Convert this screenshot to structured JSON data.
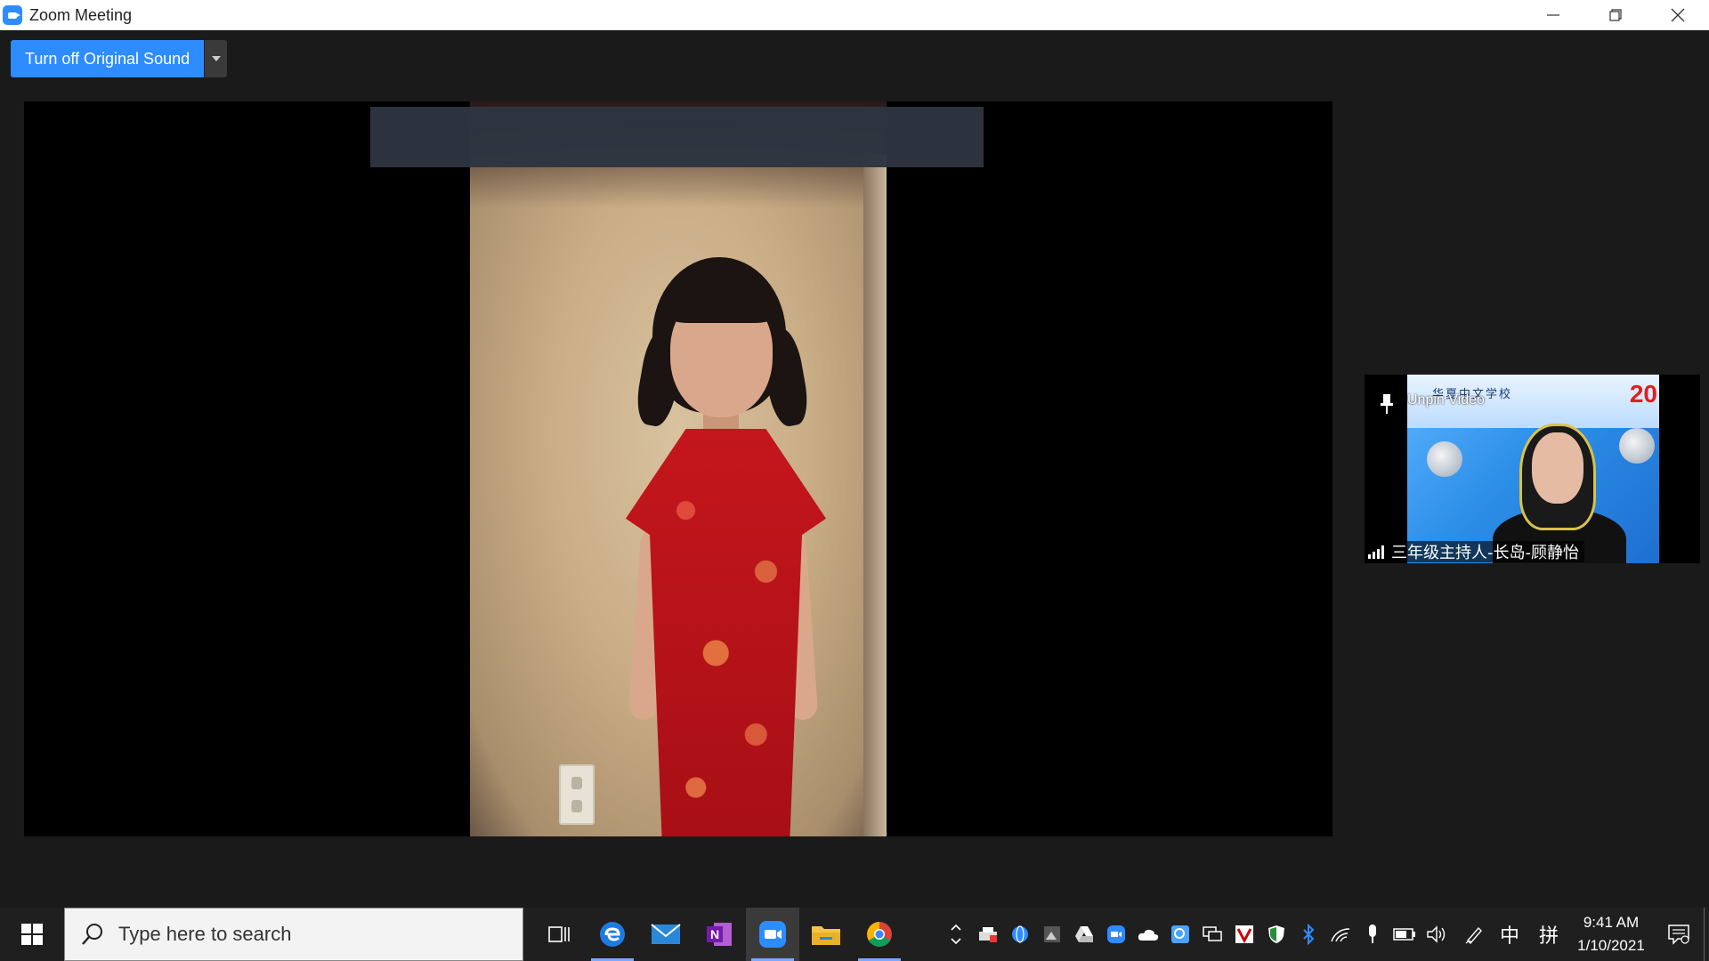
{
  "window": {
    "title": "Zoom Meeting",
    "controls": [
      "minimize",
      "restore",
      "close"
    ]
  },
  "meeting": {
    "sound_button_label": "Turn off Original Sound",
    "thumbnail": {
      "unpin_label": "Unpin Video",
      "participant_name": "三年级主持人-长岛-顾静怡",
      "background_school_text": "华夏中文学校",
      "background_year_text": "20"
    }
  },
  "taskbar": {
    "search_placeholder": "Type here to search",
    "pinned_apps": [
      "task-view",
      "edge",
      "mail",
      "onenote",
      "zoom",
      "file-explorer",
      "chrome"
    ],
    "active_app": "zoom",
    "ime_label": "中",
    "ime_mode": "拼",
    "clock": {
      "time": "9:41 AM",
      "date": "1/10/2021"
    }
  },
  "colors": {
    "zoom_blue": "#2d8cff",
    "meeting_bg": "#1a1a1a",
    "taskbar_bg": "#1f1f1f"
  }
}
